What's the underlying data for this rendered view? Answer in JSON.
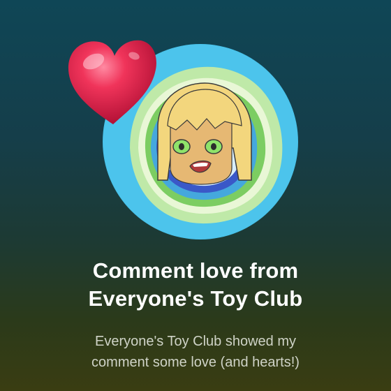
{
  "notification": {
    "title_line1": "Comment love from",
    "title_line2": "Everyone's Toy Club",
    "body_line1": "Everyone's Toy Club showed my",
    "body_line2": "comment some love (and hearts!)"
  },
  "icons": {
    "badge": "heart-icon",
    "avatar": "channel-avatar"
  },
  "colors": {
    "title": "#ffffff",
    "body": "#cfd3c7",
    "heart": "#e0254f",
    "avatar_ring": "#3ab7e3"
  }
}
